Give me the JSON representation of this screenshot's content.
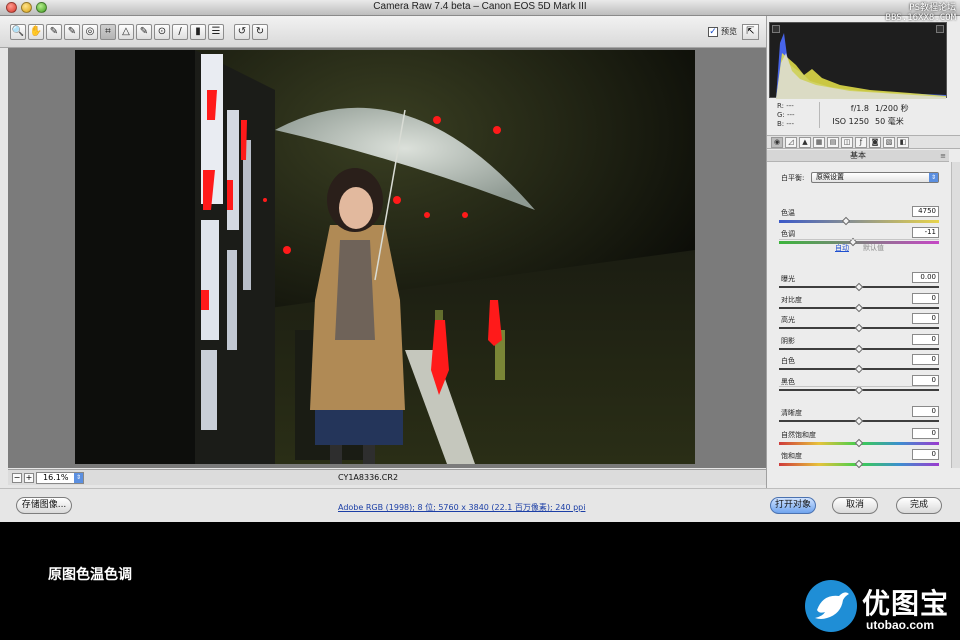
{
  "window": {
    "title": "Camera Raw 7.4 beta – Canon EOS 5D Mark III",
    "watermark_top_line1": "PS教程论坛",
    "watermark_top_line2": "BBS.16XX8.COM"
  },
  "toolbar": {
    "tools": [
      {
        "name": "zoom-tool",
        "glyph": "🔍"
      },
      {
        "name": "hand-tool",
        "glyph": "✋"
      },
      {
        "name": "white-balance-tool",
        "glyph": "✎"
      },
      {
        "name": "color-sampler-tool",
        "glyph": "✎"
      },
      {
        "name": "targeted-adjustment-tool",
        "glyph": "◎"
      },
      {
        "name": "crop-tool",
        "glyph": "⌗"
      },
      {
        "name": "straighten-tool",
        "glyph": "△"
      },
      {
        "name": "spot-removal-tool",
        "glyph": "✎"
      },
      {
        "name": "red-eye-tool",
        "glyph": "⊙"
      },
      {
        "name": "adjustment-brush-tool",
        "glyph": "/"
      },
      {
        "name": "graduated-filter-tool",
        "glyph": "▮"
      },
      {
        "name": "preferences-tool",
        "glyph": "☰"
      },
      {
        "name": "rotate-left-tool",
        "glyph": "↺"
      },
      {
        "name": "rotate-right-tool",
        "glyph": "↻"
      }
    ],
    "preview_label": "预览",
    "preview_checked": "✓",
    "fullscreen_glyph": "⇱"
  },
  "status": {
    "zoom_minus": "−",
    "zoom_plus": "+",
    "zoom_value": "16.1%",
    "filename": "CY1A8336.CR2"
  },
  "bottom": {
    "save_label": "存储图像...",
    "workflow": "Adobe RGB (1998); 8 位; 5760 x 3840 (22.1 百万像素); 240 ppi",
    "open_label": "打开对象",
    "cancel_label": "取消",
    "done_label": "完成"
  },
  "side": {
    "rgb": {
      "r": "R:  ---",
      "g": "G:  ---",
      "b": "B:  ---"
    },
    "exif": {
      "aperture": "f/1.8",
      "shutter": "1/200 秒",
      "iso": "ISO 1250",
      "focal": "50 毫米"
    },
    "panel_title": "基本",
    "panel_menu": "≡",
    "white_balance_label": "白平衡:",
    "white_balance_value": "原照设置",
    "auto_label": "自动",
    "default_label": "默认值",
    "sliders": {
      "temperature": {
        "label": "色温",
        "value": "4750",
        "level": 0.42
      },
      "tint": {
        "label": "色调",
        "value": "-11",
        "level": 0.46
      },
      "exposure": {
        "label": "曝光",
        "value": "0.00",
        "level": 0.5
      },
      "contrast": {
        "label": "对比度",
        "value": "0",
        "level": 0.5
      },
      "highlights": {
        "label": "高光",
        "value": "0",
        "level": 0.5
      },
      "shadows": {
        "label": "阴影",
        "value": "0",
        "level": 0.5
      },
      "whites": {
        "label": "白色",
        "value": "0",
        "level": 0.5
      },
      "blacks": {
        "label": "黑色",
        "value": "0",
        "level": 0.5
      },
      "clarity": {
        "label": "清晰度",
        "value": "0",
        "level": 0.5
      },
      "vibrance": {
        "label": "自然饱和度",
        "value": "0",
        "level": 0.5
      },
      "saturation": {
        "label": "饱和度",
        "value": "0",
        "level": 0.5
      }
    }
  },
  "footer": {
    "caption": "原图色温色调",
    "brand_text": "优图宝",
    "brand_url": "utobao.com"
  }
}
